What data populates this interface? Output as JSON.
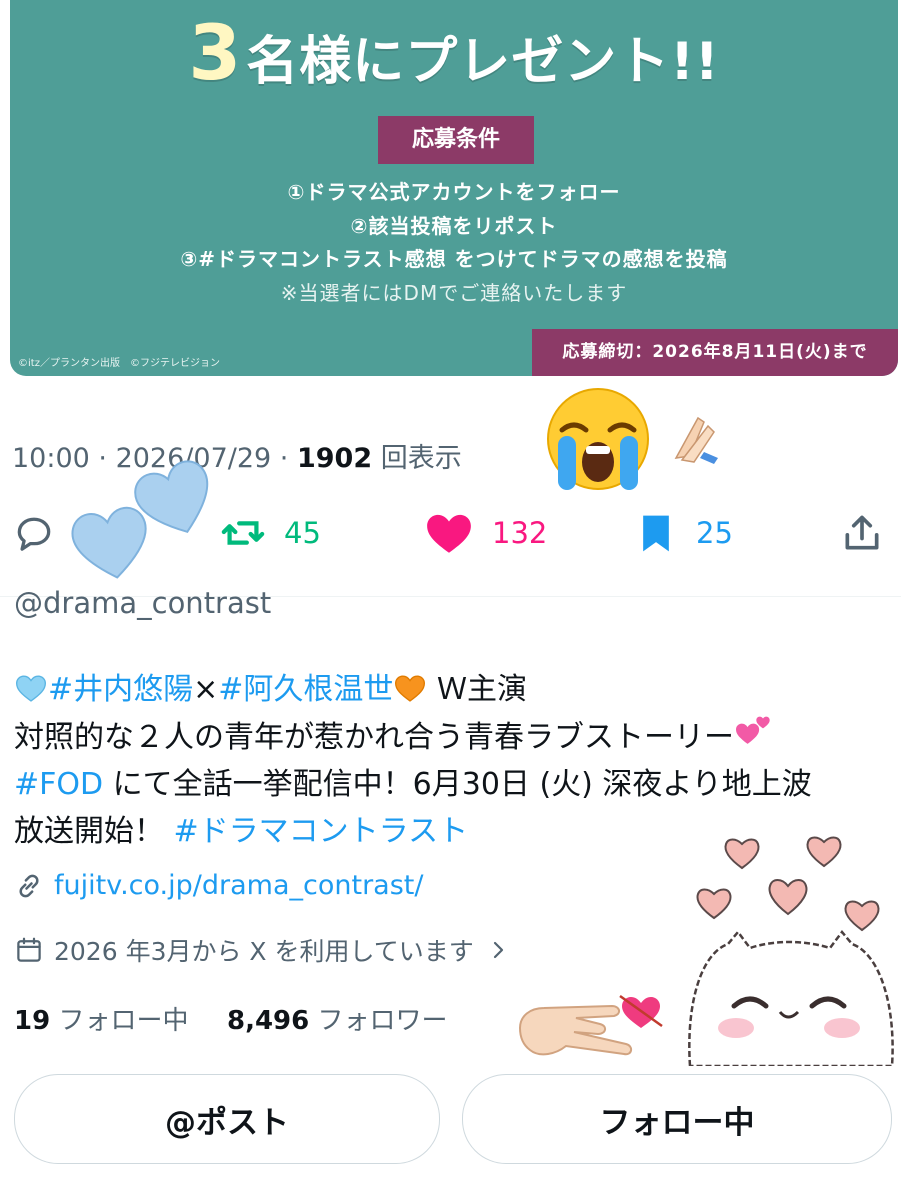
{
  "banner": {
    "headline_number": "3",
    "headline_text": "名様にプレゼント!!",
    "conditions_label": "応募条件",
    "conditions": [
      "①ドラマ公式アカウントをフォロー",
      "②該当投稿をリポスト",
      "③#ドラマコントラスト感想 をつけてドラマの感想を投稿"
    ],
    "note": "※当選者にはDMでご連絡いたします",
    "copyright": "©itz／プランタン出版　©フジテレビジョン",
    "deadline": "応募締切：2026年8月11日(火)まで",
    "colors": {
      "background": "#4f9e97",
      "label": "#8c3a67"
    }
  },
  "post": {
    "time": "10:00",
    "date": "2026/07/29",
    "views": "1902",
    "views_label": "回表示",
    "reposts": "45",
    "likes": "132",
    "bookmarks": "25",
    "colors": {
      "repost": "#00ba7c",
      "like": "#f91880",
      "bookmark": "#1d9bf0"
    }
  },
  "profile": {
    "handle": "@drama_contrast",
    "bio_tag1": "#井内悠陽",
    "bio_times": "×",
    "bio_tag2": "#阿久根温世",
    "bio_lead": "Ｗ主演",
    "bio_line2": "対照的な２人の青年が惹かれ合う青春ラブストーリー",
    "bio_tag3": "#FOD",
    "bio_line3": " にて全話一挙配信中！6月30日 (火) 深夜より地上波",
    "bio_line4": "放送開始！ ",
    "bio_tag4": "#ドラマコントラスト",
    "link": "fujitv.co.jp/drama_contrast/",
    "joined": "2026 年3月から X を利用しています",
    "following_count": "19",
    "following_label": "フォロー中",
    "followers_count": "8,496",
    "followers_label": "フォロワー"
  },
  "buttons": {
    "post": "@ポスト",
    "following": "フォロー中"
  },
  "icons": [
    "reply-icon",
    "repost-icon",
    "like-icon",
    "bookmark-icon",
    "share-icon",
    "link-icon",
    "calendar-icon",
    "chevron-right-icon"
  ]
}
